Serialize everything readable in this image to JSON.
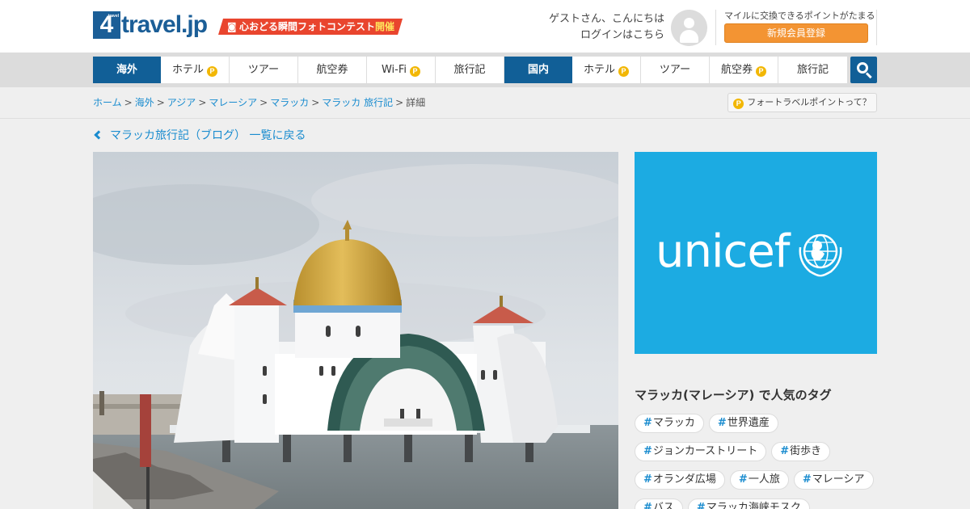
{
  "header": {
    "logo_four": "4",
    "logo_four_small": "travel",
    "logo_text": "travel.jp",
    "contest_text": "心おどる瞬間フォトコンテスト",
    "contest_highlight": "開催",
    "greeting_line1": "ゲストさん、こんにちは",
    "greeting_line2": "ログインはこちら",
    "points_note": "マイルに交換できるポイントがたまる",
    "register_label": "新規会員登録"
  },
  "nav": {
    "overseas": {
      "label": "海外",
      "items": [
        {
          "label": "ホテル",
          "badge": "P"
        },
        {
          "label": "ツアー",
          "badge": ""
        },
        {
          "label": "航空券",
          "badge": ""
        },
        {
          "label": "Wi-Fi",
          "badge": "P"
        },
        {
          "label": "旅行記",
          "badge": ""
        }
      ]
    },
    "domestic": {
      "label": "国内",
      "items": [
        {
          "label": "ホテル",
          "badge": "P"
        },
        {
          "label": "ツアー",
          "badge": ""
        },
        {
          "label": "航空券",
          "badge": "P"
        },
        {
          "label": "旅行記",
          "badge": ""
        }
      ]
    }
  },
  "breadcrumb": {
    "links": [
      "ホーム",
      "海外",
      "アジア",
      "マレーシア",
      "マラッカ",
      "マラッカ 旅行記"
    ],
    "current": "詳細",
    "separator": ">"
  },
  "points_link": {
    "badge": "P",
    "label": "フォートラベルポイントって？"
  },
  "backlink": {
    "label": "マラッカ旅行記（ブログ） 一覧に戻る"
  },
  "ad": {
    "text": "unicef",
    "bg_color": "#1cabe2"
  },
  "tags": {
    "title": "マラッカ(マレーシア) で人気のタグ",
    "rows": [
      [
        "マラッカ",
        "世界遺産"
      ],
      [
        "ジョンカーストリート",
        "街歩き"
      ],
      [
        "オランダ広場",
        "一人旅",
        "マレーシア"
      ],
      [
        "バス",
        "マラッカ海峡モスク"
      ]
    ]
  },
  "colors": {
    "brand": "#115f97",
    "link": "#1a8ccf",
    "accent": "#f39433"
  }
}
